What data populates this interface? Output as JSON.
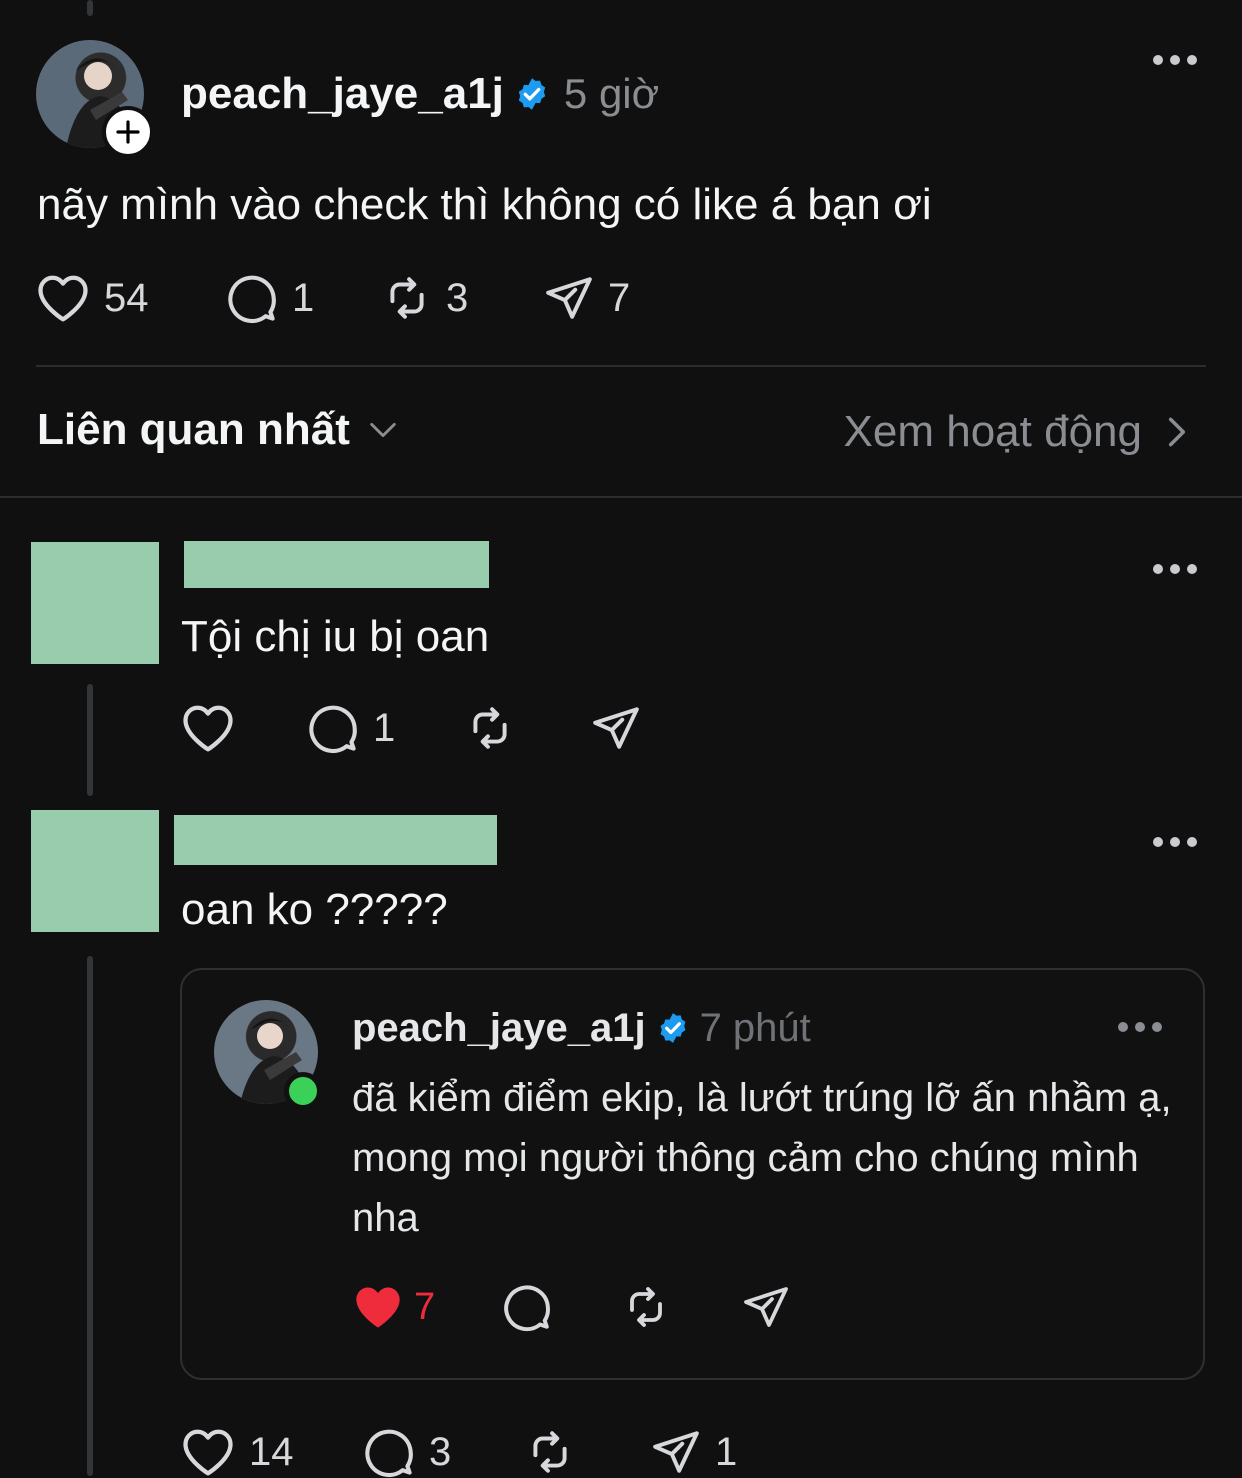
{
  "post": {
    "username": "peach_jaye_a1j",
    "time": "5 giờ",
    "text": "nãy mình vào check thì không có like á bạn ơi",
    "likes": "54",
    "replies": "1",
    "reposts": "3",
    "shares": "7"
  },
  "sort": {
    "label": "Liên quan nhất",
    "activity_link": "Xem hoạt động"
  },
  "comments": [
    {
      "text": "Tội chị iu bị oan",
      "likes": "",
      "replies": "1",
      "reposts": "",
      "shares": ""
    },
    {
      "text": "oan ko ?????",
      "likes": "14",
      "replies": "3",
      "reposts": "",
      "shares": "1"
    }
  ],
  "quoted": {
    "username": "peach_jaye_a1j",
    "time": "7 phút",
    "text": "đã kiểm điểm ekip, là lướt trúng lỡ ấn nhầm ạ, mong mọi người thông cảm cho chúng mình nha",
    "likes": "7"
  },
  "colors": {
    "background": "#101010",
    "verified": "#1d9bf0",
    "like_red": "#ee2c3c",
    "online": "#3bd159",
    "redaction": "#99cbad"
  },
  "icons": [
    "heart-icon",
    "comment-icon",
    "repost-icon",
    "share-icon",
    "verified-icon",
    "more-icon",
    "chevron-down-icon",
    "chevron-right-icon",
    "follow-plus-icon"
  ]
}
